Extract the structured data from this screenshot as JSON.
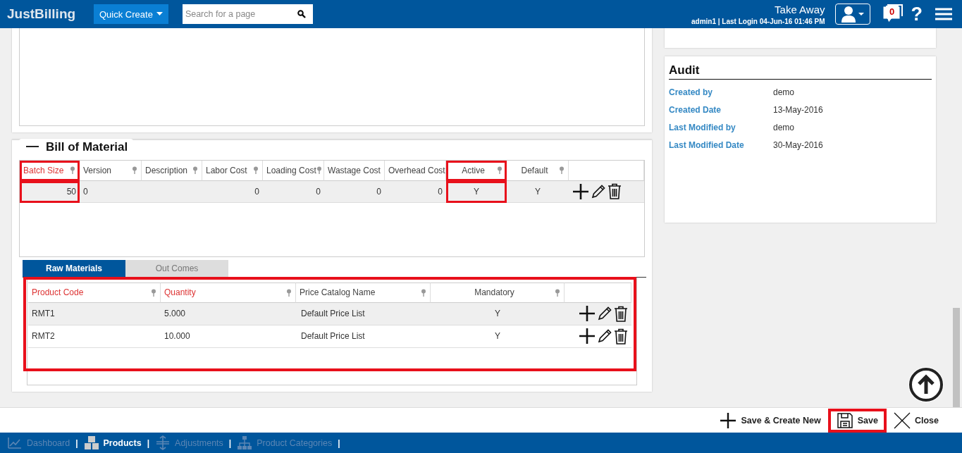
{
  "header": {
    "logo": "JustBilling",
    "quick_create": "Quick Create",
    "search": {
      "placeholder": "Search for a page"
    },
    "store": "Take Away",
    "login_info": "admin1 | Last Login 04-Jun-16 01:46 PM",
    "notifications": "0",
    "help": "?"
  },
  "bom": {
    "title": "Bill of Material",
    "columns": [
      {
        "label": "Batch Size",
        "required": true,
        "highlighted": true,
        "filter": true
      },
      {
        "label": "Version",
        "required": false,
        "highlighted": false,
        "filter": true
      },
      {
        "label": "Description",
        "required": false,
        "highlighted": false,
        "filter": true
      },
      {
        "label": "Labor Cost",
        "required": false,
        "highlighted": false,
        "filter": true
      },
      {
        "label": "Loading Cost",
        "required": false,
        "highlighted": false,
        "filter": true
      },
      {
        "label": "Wastage Cost",
        "required": false,
        "highlighted": false,
        "filter": false
      },
      {
        "label": "Overhead Cost",
        "required": false,
        "highlighted": false,
        "filter": false
      },
      {
        "label": "Active",
        "required": false,
        "highlighted": true,
        "filter": true
      },
      {
        "label": "Default",
        "required": false,
        "highlighted": false,
        "filter": true
      }
    ],
    "rows": [
      {
        "selected": true,
        "cells": [
          "50",
          "0",
          "",
          "0",
          "0",
          "0",
          "0",
          "Y",
          "Y"
        ]
      }
    ]
  },
  "tabs": [
    {
      "label": "Raw Materials",
      "selected": true
    },
    {
      "label": "Out Comes",
      "selected": false
    }
  ],
  "raw_materials": {
    "highlighted": true,
    "columns": [
      {
        "label": "Product Code",
        "required": true,
        "filter": true
      },
      {
        "label": "Quantity",
        "required": true,
        "filter": true
      },
      {
        "label": "Price Catalog Name",
        "required": false,
        "filter": true
      },
      {
        "label": "Mandatory",
        "required": false,
        "filter": true
      }
    ],
    "rows": [
      {
        "selected": true,
        "cells": [
          "RMT1",
          "5.000",
          "Default Price List",
          "Y"
        ]
      },
      {
        "selected": false,
        "cells": [
          "RMT2",
          "10.000",
          "Default Price List",
          "Y"
        ]
      }
    ]
  },
  "audit": {
    "title": "Audit",
    "fields": [
      {
        "label": "Created by",
        "value": "demo"
      },
      {
        "label": "Created Date",
        "value": "13-May-2016"
      },
      {
        "label": "Last Modified by",
        "value": "demo"
      },
      {
        "label": "Last Modified Date",
        "value": "30-May-2016"
      }
    ]
  },
  "actions": [
    {
      "kind": "add",
      "label": "Save & Create New",
      "highlighted": false
    },
    {
      "kind": "save",
      "label": "Save",
      "highlighted": true
    },
    {
      "kind": "close",
      "label": "Close",
      "highlighted": false
    }
  ],
  "bottom_nav": [
    {
      "kind": "chart",
      "label": "Dashboard",
      "selected": false,
      "separator": "|"
    },
    {
      "kind": "boxes",
      "label": "Products",
      "selected": true,
      "separator": "|"
    },
    {
      "kind": "adjust",
      "label": "Adjustments",
      "selected": false,
      "separator": "|"
    },
    {
      "kind": "tree",
      "label": "Product Categories",
      "selected": false,
      "separator": "|"
    }
  ]
}
